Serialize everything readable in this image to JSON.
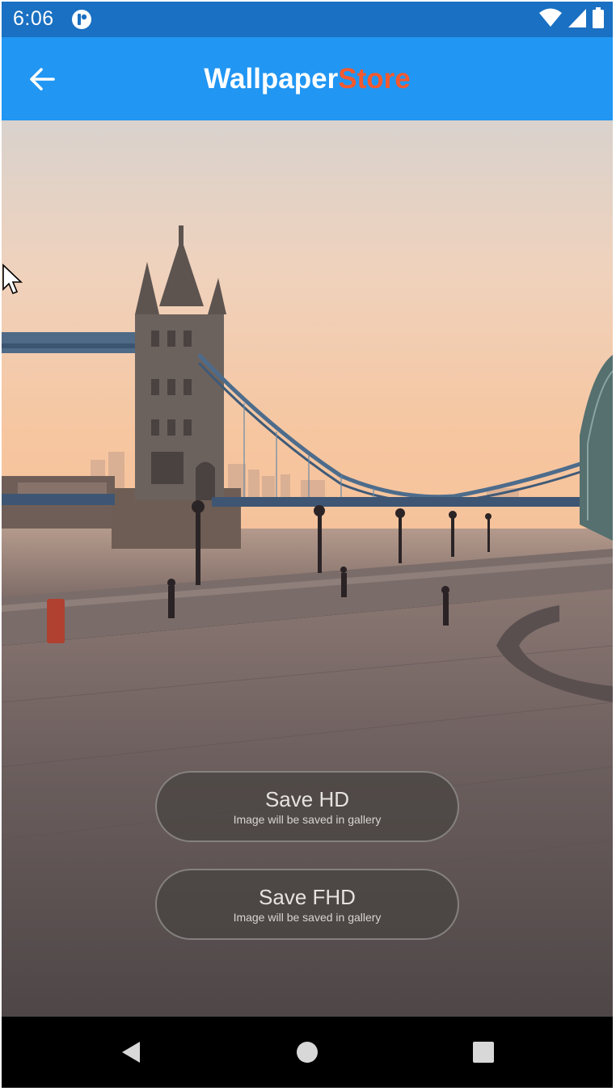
{
  "status_bar": {
    "time": "6:06",
    "icons": [
      "app-notification-icon",
      "wifi-icon",
      "signal-icon",
      "battery-icon"
    ]
  },
  "app_bar": {
    "back_icon": "arrow-left-icon",
    "title_part1": "Wallpaper",
    "title_part2": "Store",
    "title_color1": "#ffffff",
    "title_color2": "#f4592f",
    "background": "#2196f3"
  },
  "wallpaper": {
    "description_icon": "wallpaper-image"
  },
  "actions": {
    "save_hd": {
      "label": "Save HD",
      "subtitle": "Image will be saved in gallery"
    },
    "save_fhd": {
      "label": "Save FHD",
      "subtitle": "Image will be saved in gallery"
    }
  },
  "nav_bar": {
    "icons": [
      "back-triangle-icon",
      "home-circle-icon",
      "recents-square-icon"
    ]
  }
}
